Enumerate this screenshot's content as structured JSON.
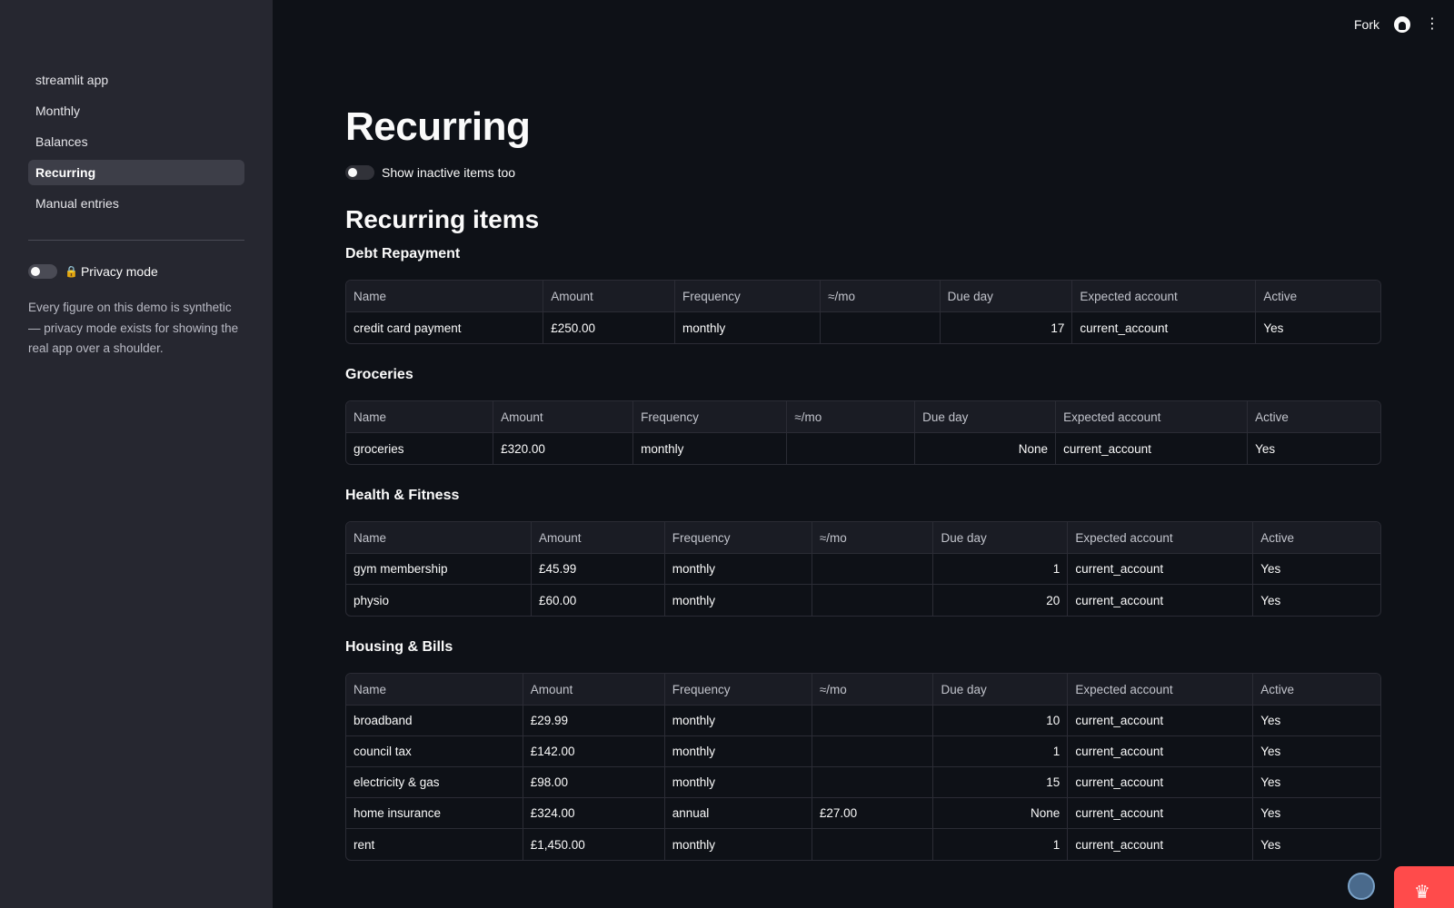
{
  "sidebar": {
    "nav": [
      "streamlit app",
      "Monthly",
      "Balances",
      "Recurring",
      "Manual entries"
    ],
    "active_index": 3,
    "privacy_label": "Privacy mode",
    "privacy_on": false,
    "note": "Every figure on this demo is synthetic — privacy mode exists for showing the real app over a shoulder."
  },
  "header": {
    "fork_label": "Fork"
  },
  "main": {
    "title": "Recurring",
    "inactive_label": "Show inactive items too",
    "section_title": "Recurring items",
    "columns": [
      "Name",
      "Amount",
      "Frequency",
      "≈/mo",
      "Due day",
      "Expected account",
      "Active"
    ],
    "groups": [
      {
        "title": "Debt Repayment",
        "widths": [
          213,
          142,
          157,
          129,
          143,
          198,
          134
        ],
        "rows": [
          [
            "credit card payment",
            "£250.00",
            "monthly",
            "",
            "17",
            "current_account",
            "Yes"
          ]
        ]
      },
      {
        "title": "Groceries",
        "widths": [
          159,
          151,
          166,
          138,
          152,
          207,
          143
        ],
        "rows": [
          [
            "groceries",
            "£320.00",
            "monthly",
            "",
            "None",
            "current_account",
            "Yes"
          ]
        ]
      },
      {
        "title": "Health & Fitness",
        "widths": [
          200,
          144,
          159,
          131,
          145,
          200,
          137
        ],
        "rows": [
          [
            "gym membership",
            "£45.99",
            "monthly",
            "",
            "1",
            "current_account",
            "Yes"
          ],
          [
            "physio",
            "£60.00",
            "monthly",
            "",
            "20",
            "current_account",
            "Yes"
          ]
        ]
      },
      {
        "title": "Housing & Bills",
        "widths": [
          191,
          153,
          159,
          131,
          145,
          200,
          137
        ],
        "rows": [
          [
            "broadband",
            "£29.99",
            "monthly",
            "",
            "10",
            "current_account",
            "Yes"
          ],
          [
            "council tax",
            "£142.00",
            "monthly",
            "",
            "1",
            "current_account",
            "Yes"
          ],
          [
            "electricity & gas",
            "£98.00",
            "monthly",
            "",
            "15",
            "current_account",
            "Yes"
          ],
          [
            "home insurance",
            "£324.00",
            "annual",
            "£27.00",
            "None",
            "current_account",
            "Yes"
          ],
          [
            "rent",
            "£1,450.00",
            "monthly",
            "",
            "1",
            "current_account",
            "Yes"
          ]
        ]
      }
    ]
  },
  "colors": {
    "background": "#0e1117",
    "sidebar": "#262730",
    "accent": "#ff4b4b"
  }
}
